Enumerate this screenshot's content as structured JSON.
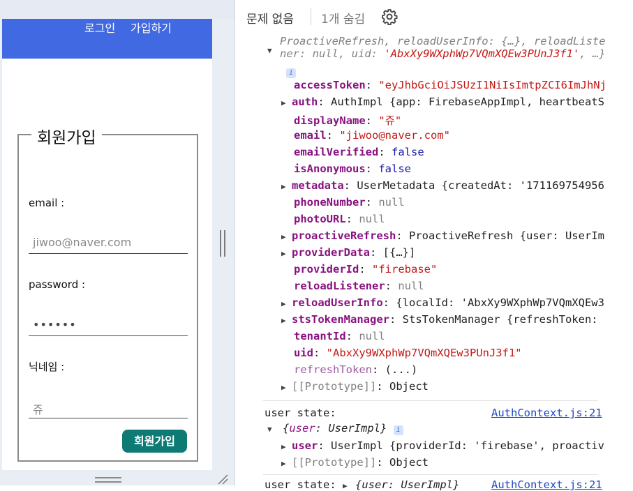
{
  "app": {
    "nav": {
      "login": "로그인",
      "signup": "가입하기"
    },
    "form": {
      "legend": "회원가입",
      "email_label": "email :",
      "email_value": "jiwoo@naver.com",
      "password_label": "password :",
      "password_value": "••••••",
      "nickname_label": "닉네임 :",
      "nickname_value": "쥬",
      "submit_label": "회원가입"
    }
  },
  "devtools": {
    "toolbar": {
      "issues": "문제 없음",
      "hidden": "1개 숨김"
    },
    "colors": {
      "key": "#881280",
      "string": "#c41a16",
      "number": "#1a1aa6",
      "muted": "#808080",
      "link": "#1a47c7"
    },
    "object": {
      "header_l1": "ProactiveRefresh, reloadUserInfo: {…}, reloadListe",
      "header_l2a": "ner: null, uid: ",
      "header_l2b": "'AbxXy9WXphWp7VQmXQEw3PUnJ3f1'",
      "header_l2c": ", …}",
      "info_badge": "i",
      "props": [
        {
          "key": "accessToken",
          "sep": ": ",
          "val": "\"eyJhbGciOiJSUzI1NiIsImtpZCI6ImJhNjl",
          "vclass": "s",
          "arrow": false,
          "kclass": "k"
        },
        {
          "key": "auth",
          "sep": ": ",
          "val": "AuthImpl {app: FirebaseAppImpl, heartbeatSer",
          "vclass": "d",
          "arrow": true,
          "kclass": "k"
        },
        {
          "key": "displayName",
          "sep": ": ",
          "val": "\"쥬\"",
          "vclass": "s",
          "arrow": false,
          "kclass": "k"
        },
        {
          "key": "email",
          "sep": ": ",
          "val": "\"jiwoo@naver.com\"",
          "vclass": "s",
          "arrow": false,
          "kclass": "k"
        },
        {
          "key": "emailVerified",
          "sep": ": ",
          "val": "false",
          "vclass": "n",
          "arrow": false,
          "kclass": "k"
        },
        {
          "key": "isAnonymous",
          "sep": ": ",
          "val": "false",
          "vclass": "n",
          "arrow": false,
          "kclass": "k"
        },
        {
          "key": "metadata",
          "sep": ": ",
          "val": "UserMetadata {createdAt: '1711697549567",
          "vclass": "d",
          "arrow": true,
          "kclass": "k"
        },
        {
          "key": "phoneNumber",
          "sep": ": ",
          "val": "null",
          "vclass": "g",
          "arrow": false,
          "kclass": "k"
        },
        {
          "key": "photoURL",
          "sep": ": ",
          "val": "null",
          "vclass": "g",
          "arrow": false,
          "kclass": "k"
        },
        {
          "key": "proactiveRefresh",
          "sep": ": ",
          "val": "ProactiveRefresh {user: UserIm",
          "vclass": "d",
          "arrow": true,
          "kclass": "k"
        },
        {
          "key": "providerData",
          "sep": ": ",
          "val": "[{…}]",
          "vclass": "d",
          "arrow": true,
          "kclass": "k"
        },
        {
          "key": "providerId",
          "sep": ": ",
          "val": "\"firebase\"",
          "vclass": "s",
          "arrow": false,
          "kclass": "k"
        },
        {
          "key": "reloadListener",
          "sep": ": ",
          "val": "null",
          "vclass": "g",
          "arrow": false,
          "kclass": "k"
        },
        {
          "key": "reloadUserInfo",
          "sep": ": ",
          "val": "{localId: 'AbxXy9WXphWp7VQmXQEw3I",
          "vclass": "d",
          "arrow": true,
          "kclass": "k"
        },
        {
          "key": "stsTokenManager",
          "sep": ": ",
          "val": "StsTokenManager {refreshToken:",
          "vclass": "d",
          "arrow": true,
          "kclass": "k"
        },
        {
          "key": "tenantId",
          "sep": ": ",
          "val": "null",
          "vclass": "g",
          "arrow": false,
          "kclass": "k"
        },
        {
          "key": "uid",
          "sep": ": ",
          "val": "\"AbxXy9WXphWp7VQmXQEw3PUnJ3f1\"",
          "vclass": "s",
          "arrow": false,
          "kclass": "k"
        },
        {
          "key": "refreshToken",
          "sep": ": ",
          "val": "(...)",
          "vclass": "d",
          "arrow": false,
          "kclass": "kd"
        },
        {
          "key": "[[Prototype]]",
          "sep": ": ",
          "val": "Object",
          "vclass": "d",
          "arrow": true,
          "kclass": "g"
        }
      ]
    },
    "log2": {
      "label": "user state:",
      "source": "AuthContext.js:21",
      "summary_key": "user",
      "summary_val": "UserImpl",
      "user_key": "user",
      "user_val": "UserImpl {providerId: 'firebase', proactiveR",
      "proto_key": "[[Prototype]]",
      "proto_val": "Object"
    },
    "log3": {
      "label": "user state:",
      "summary": "{user: UserImpl}",
      "source": "AuthContext.js:21"
    }
  }
}
